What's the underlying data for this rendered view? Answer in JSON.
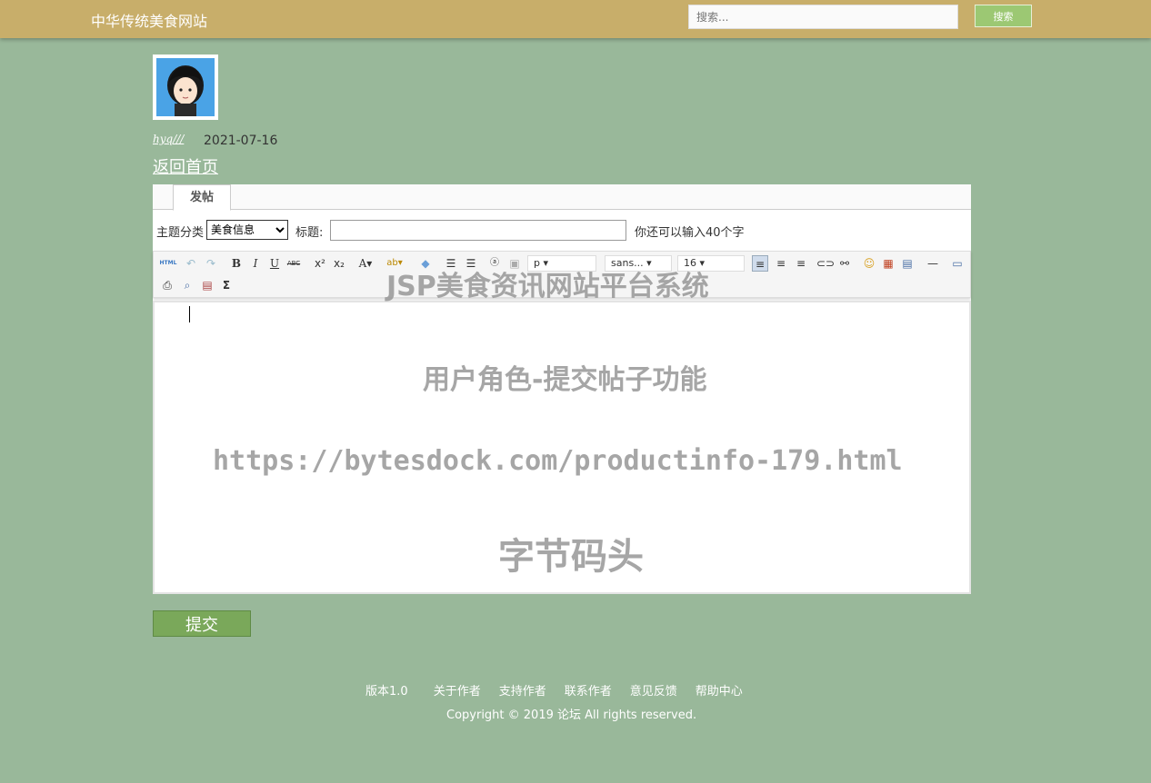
{
  "header": {
    "site_title": "中华传统美食网站",
    "search_placeholder": "搜索...",
    "search_button": "搜索"
  },
  "author": {
    "username": "hyq///",
    "date": "2021-07-16",
    "back_link": "返回首页"
  },
  "tabs": [
    {
      "label": "发帖"
    }
  ],
  "form": {
    "category_label": "主题分类",
    "category_selected": "美食信息",
    "title_label": "标题:",
    "title_value": "",
    "remaining_hint": "你还可以输入40个字"
  },
  "editor": {
    "paragraph_select": "p",
    "font_select": "sans...",
    "size_select": "16",
    "toolbar_labels": {
      "html": "HTML",
      "bold": "B",
      "italic": "I",
      "underline": "U",
      "strike": "ABC",
      "sum": "Σ"
    }
  },
  "submit_button": "提交",
  "watermark": {
    "line1": "JSP美食资讯网站平台系统",
    "line2": "用户角色-提交帖子功能",
    "line3": "https://bytesdock.com/productinfo-179.html",
    "line4": "字节码头"
  },
  "footer": {
    "links": [
      "版本1.0",
      "关于作者",
      "支持作者",
      "联系作者",
      "意见反馈",
      "帮助中心"
    ],
    "copyright": "Copyright © 2019 论坛 All rights reserved."
  },
  "colors": {
    "page_bg": "#99b89a",
    "topbar_bg": "#c8ae6a",
    "search_button_bg": "#9cc873",
    "submit_button_bg": "#7aa85a"
  }
}
